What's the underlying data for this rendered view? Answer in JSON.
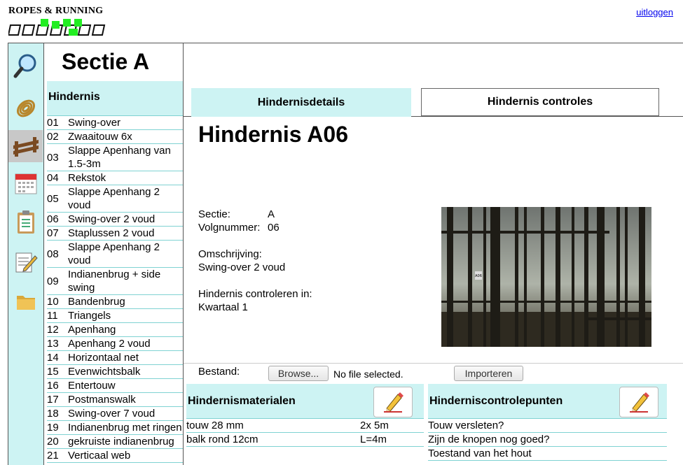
{
  "header": {
    "logo_text": "ROPES & RUNNING",
    "logout": "uitloggen"
  },
  "iconbar": {
    "items": [
      {
        "icon": "magnifier-icon",
        "active": false
      },
      {
        "icon": "rope-icon",
        "active": false
      },
      {
        "icon": "fence-icon",
        "active": true
      },
      {
        "icon": "calendar-icon",
        "active": false
      },
      {
        "icon": "clipboard-icon",
        "active": false
      },
      {
        "icon": "notepad-icon",
        "active": false
      },
      {
        "icon": "folder-icon",
        "active": false
      }
    ]
  },
  "section": {
    "title": "Sectie A",
    "list_header": "Hindernis",
    "items": [
      {
        "num": "01",
        "name": "Swing-over"
      },
      {
        "num": "02",
        "name": "Zwaaitouw 6x"
      },
      {
        "num": "03",
        "name": "Slappe Apenhang van 1.5-3m"
      },
      {
        "num": "04",
        "name": "Rekstok"
      },
      {
        "num": "05",
        "name": "Slappe Apenhang 2 voud"
      },
      {
        "num": "06",
        "name": "Swing-over 2 voud"
      },
      {
        "num": "07",
        "name": "Staplussen 2 voud"
      },
      {
        "num": "08",
        "name": "Slappe Apenhang 2 voud"
      },
      {
        "num": "09",
        "name": "Indianenbrug + side swing"
      },
      {
        "num": "10",
        "name": "Bandenbrug"
      },
      {
        "num": "11",
        "name": "Triangels"
      },
      {
        "num": "12",
        "name": "Apenhang"
      },
      {
        "num": "13",
        "name": "Apenhang 2 voud"
      },
      {
        "num": "14",
        "name": "Horizontaal net"
      },
      {
        "num": "15",
        "name": "Evenwichtsbalk"
      },
      {
        "num": "16",
        "name": "Entertouw"
      },
      {
        "num": "17",
        "name": "Postmanswalk"
      },
      {
        "num": "18",
        "name": "Swing-over 7 voud"
      },
      {
        "num": "19",
        "name": "Indianenbrug met ringen"
      },
      {
        "num": "20",
        "name": "gekruiste indianenbrug"
      },
      {
        "num": "21",
        "name": "Verticaal web"
      }
    ]
  },
  "tabs": [
    {
      "label": "Hindernisdetails",
      "active": true
    },
    {
      "label": "Hindernis controles",
      "active": false
    }
  ],
  "detail": {
    "title": "Hindernis A06",
    "sectie_label": "Sectie:",
    "sectie_value": "A",
    "volg_label": "Volgnummer:",
    "volg_value": "06",
    "omschrijving_label": "Omschrijving:",
    "omschrijving_value": "Swing-over 2 voud",
    "controleren_label": "Hindernis controleren in:",
    "controleren_value": "Kwartaal 1",
    "photo_tag": "A06"
  },
  "file": {
    "label": "Bestand:",
    "browse": "Browse...",
    "status": "No file selected.",
    "import": "Importeren"
  },
  "materials": {
    "title": "Hindernismaterialen",
    "rows": [
      {
        "name": "touw 28 mm",
        "qty": "2x 5m"
      },
      {
        "name": "balk rond 12cm",
        "qty": "L=4m"
      }
    ]
  },
  "checkpoints": {
    "title": "Hinderniscontrolepunten",
    "rows": [
      {
        "name": "Touw versleten?"
      },
      {
        "name": "Zijn de knopen nog goed?"
      },
      {
        "name": "Toestand van het hout"
      }
    ]
  },
  "colors": {
    "accent": "#cdf3f3",
    "rule": "#7fd2d2",
    "logo_green": "#22ee22"
  }
}
